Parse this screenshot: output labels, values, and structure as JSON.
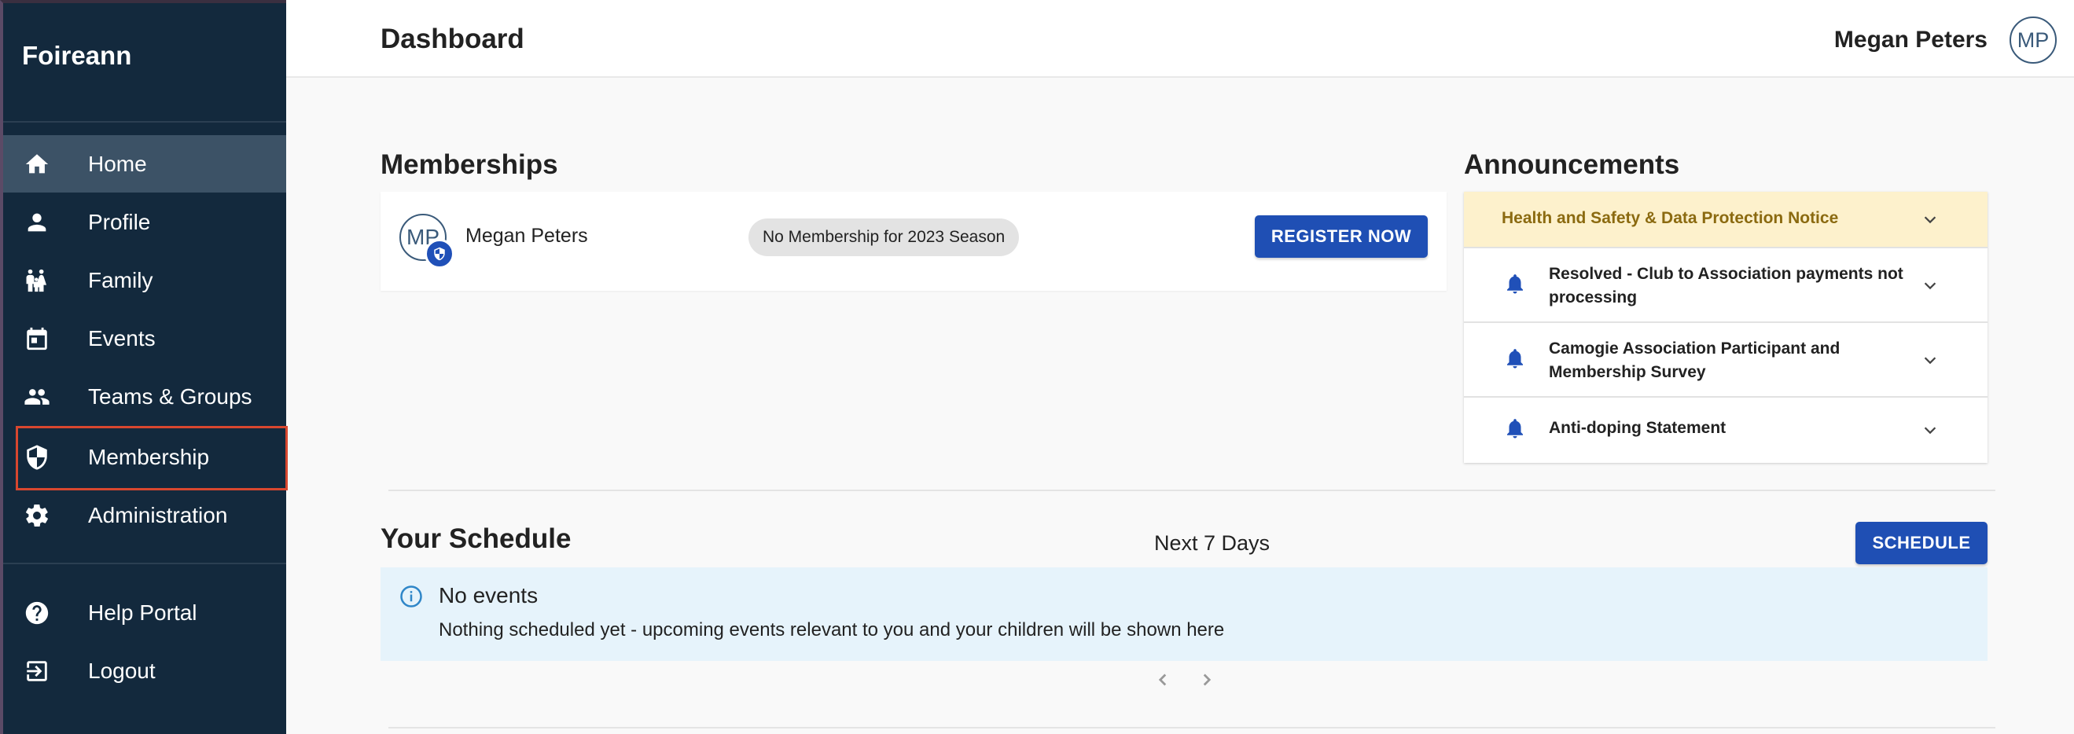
{
  "app": {
    "brand": "Foireann"
  },
  "sidebar": {
    "items": [
      {
        "label": "Home",
        "icon": "home-icon"
      },
      {
        "label": "Profile",
        "icon": "person-icon"
      },
      {
        "label": "Family",
        "icon": "family-icon"
      },
      {
        "label": "Events",
        "icon": "calendar-icon"
      },
      {
        "label": "Teams & Groups",
        "icon": "group-icon"
      },
      {
        "label": "Membership",
        "icon": "shield-icon"
      },
      {
        "label": "Administration",
        "icon": "gear-icon"
      }
    ],
    "footer_items": [
      {
        "label": "Help Portal",
        "icon": "help-icon"
      },
      {
        "label": "Logout",
        "icon": "logout-icon"
      }
    ],
    "active_item": "Home",
    "highlighted_item": "Membership"
  },
  "header": {
    "title": "Dashboard",
    "user_name": "Megan Peters",
    "user_initials": "MP"
  },
  "memberships": {
    "title": "Memberships",
    "member": {
      "initials": "MP",
      "name": "Megan Peters",
      "status": "No Membership for 2023 Season"
    },
    "register_label": "REGISTER NOW"
  },
  "announcements": {
    "title": "Announcements",
    "notice": "Health and Safety & Data Protection Notice",
    "items": [
      {
        "text": "Resolved - Club to Association payments not processing"
      },
      {
        "text": "Camogie Association Participant and Membership Survey"
      },
      {
        "text": "Anti-doping Statement"
      }
    ]
  },
  "schedule": {
    "title": "Your Schedule",
    "range": "Next 7 Days",
    "button_label": "SCHEDULE",
    "empty_title": "No events",
    "empty_text": "Nothing scheduled yet - upcoming events relevant to you and your children will be shown here"
  },
  "colors": {
    "sidebar_bg": "#13293d",
    "accent": "#1f4fb4",
    "notice_bg": "#fdf1cc",
    "info_bg": "#e6f3fb",
    "highlight": "#d8472f"
  }
}
